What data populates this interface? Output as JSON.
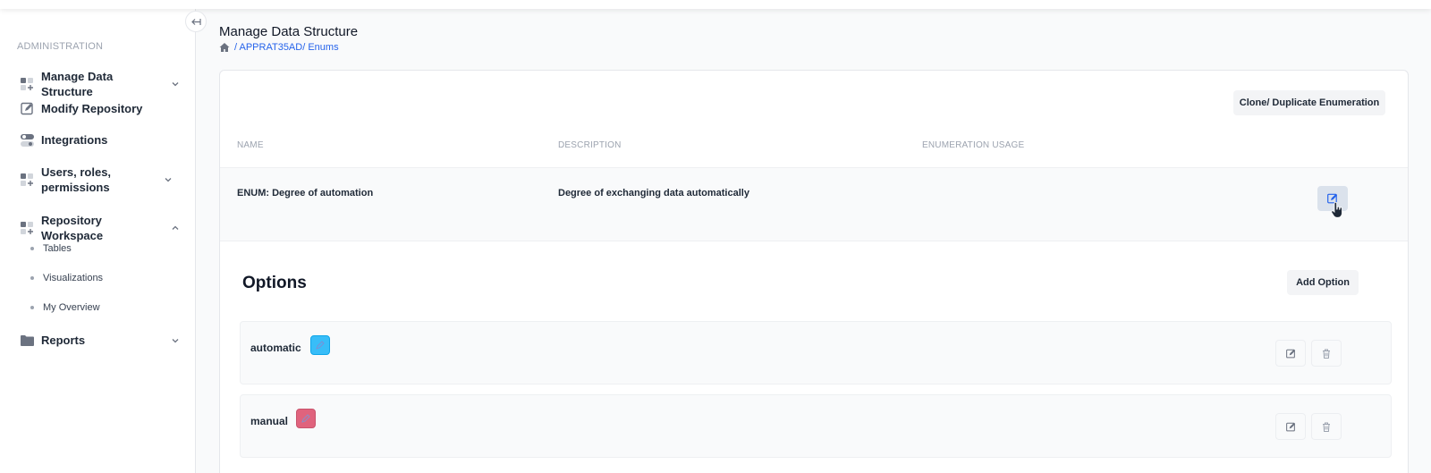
{
  "sidebar": {
    "section_label": "ADMINISTRATION",
    "items": [
      {
        "label": "Manage Data Structure",
        "icon": "grid-plus-icon"
      },
      {
        "label": "Modify Repository",
        "icon": "edit-square-icon"
      },
      {
        "label": "Integrations",
        "icon": "toggle-icon"
      },
      {
        "label": "Users, roles, permissions",
        "icon": "grid-plus-icon"
      },
      {
        "label": "Repository Workspace",
        "icon": "grid-plus-icon"
      },
      {
        "label": "Reports",
        "icon": "folder-icon"
      }
    ],
    "sub_items": [
      {
        "label": "Tables"
      },
      {
        "label": "Visualizations"
      },
      {
        "label": "My Overview"
      }
    ]
  },
  "header": {
    "title": "Manage Data Structure",
    "breadcrumb": "/ APPRAT35AD/ Enums"
  },
  "card": {
    "clone_label": "Clone/ Duplicate Enumeration",
    "columns": {
      "name": "NAME",
      "description": "DESCRIPTION",
      "usage": "ENUMERATION USAGE"
    },
    "enum": {
      "name": "ENUM: Degree of automation",
      "description": "Degree of exchanging data automatically"
    },
    "options_title": "Options",
    "add_option_label": "Add Option",
    "options": [
      {
        "label": "automatic",
        "color": "#38bdf8"
      },
      {
        "label": "manual",
        "color": "#e0637d"
      }
    ]
  },
  "colors": {
    "accent": "#2563eb",
    "edit_button_bg": "#dbe2ec"
  }
}
